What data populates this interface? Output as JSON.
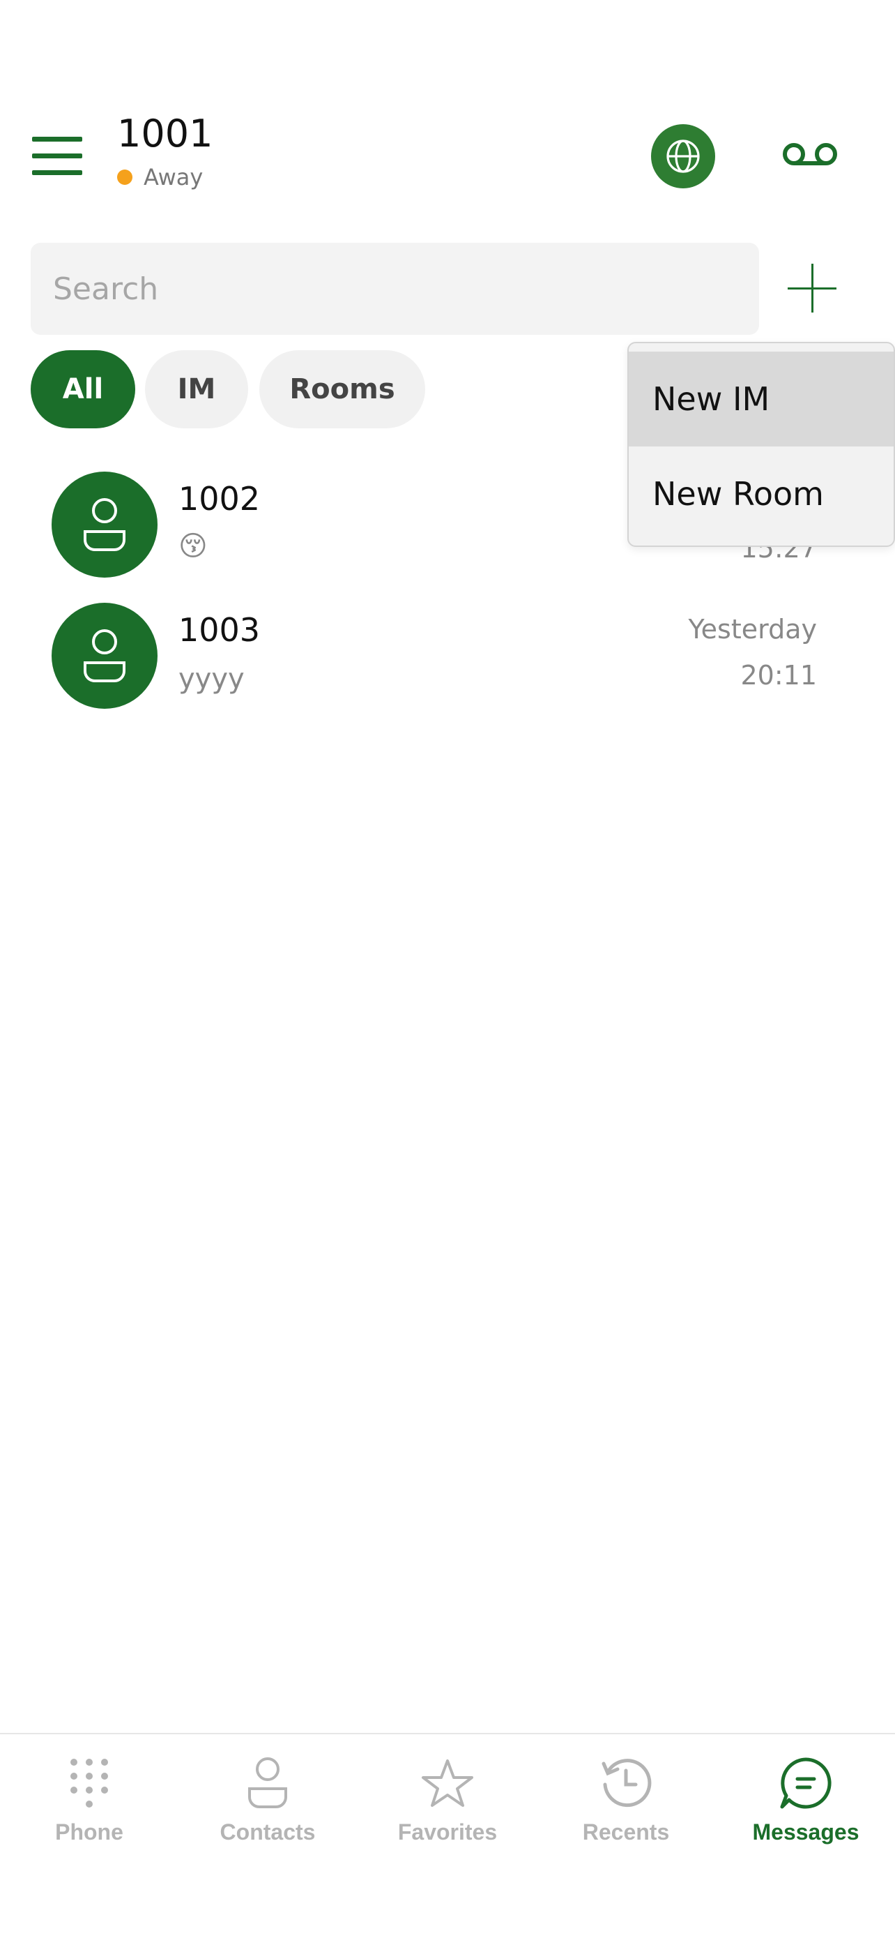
{
  "header": {
    "user_id": "1001",
    "status_text": "Away",
    "status_color": "#f5a11c",
    "menu_icon": "hamburger-menu-icon",
    "globe_icon": "globe-icon",
    "voicemail_icon": "voicemail-icon"
  },
  "search": {
    "placeholder": "Search",
    "value": ""
  },
  "add_button_icon": "plus-icon",
  "filters": {
    "all": "All",
    "im": "IM",
    "rooms": "Rooms",
    "selected": "All"
  },
  "conversations": [
    {
      "name": "1002",
      "preview": "😚",
      "date": "",
      "time": "15:27"
    },
    {
      "name": "1003",
      "preview": "yyyy",
      "date": "Yesterday",
      "time": "20:11"
    }
  ],
  "dropdown": {
    "items": [
      "New IM",
      "New Room"
    ],
    "highlighted": "New IM"
  },
  "bottom_nav": {
    "phone": "Phone",
    "contacts": "Contacts",
    "favorites": "Favorites",
    "recents": "Recents",
    "messages": "Messages",
    "active": "Messages"
  },
  "colors": {
    "brand": "#1b6e2a",
    "status_away": "#f5a11c",
    "inactive_nav": "#b4b4b4"
  }
}
